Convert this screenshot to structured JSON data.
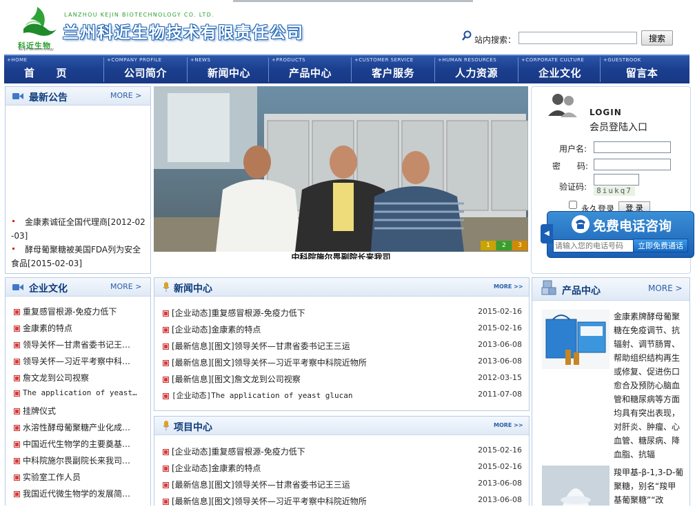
{
  "header": {
    "logo_cn": "科近生物",
    "logo_en": "Ke Jin Biotechnology",
    "company_en": "LANZHOU KEJIN BIOTECHNOLOGY CO. LTD.",
    "company_cn": "兰州科近生物技术有限责任公司",
    "search_label": "站内搜索：",
    "search_value": "",
    "search_button": "搜索"
  },
  "nav": [
    {
      "en": "+HOME",
      "cn": "首　　页"
    },
    {
      "en": "+COMPANY PROFILE",
      "cn": "公司简介"
    },
    {
      "en": "+NEWS",
      "cn": "新闻中心"
    },
    {
      "en": "+PRODUCTS",
      "cn": "产品中心"
    },
    {
      "en": "+CUSTOMER SERVICE",
      "cn": "客户服务"
    },
    {
      "en": "+HUMAN RESOURCES",
      "cn": "人力资源"
    },
    {
      "en": "+CORPORATE CULTURE",
      "cn": "企业文化"
    },
    {
      "en": "+GUESTBOOK",
      "cn": "留言本"
    }
  ],
  "announcements": {
    "title": "最新公告",
    "more": "MORE >",
    "items": [
      {
        "line1": "金康素诚征全国代理商[2012-02",
        "line2": "-03]"
      },
      {
        "line1": "酵母葡聚糖被美国FDA列为安全",
        "line2": "食品[2015-02-03]"
      }
    ]
  },
  "photo": {
    "caption": "中科院施尔畏副院长来我司",
    "slides": [
      "1",
      "2",
      "3"
    ]
  },
  "login": {
    "title_en": "LOGIN",
    "title_cn": "会员登陆入口",
    "username_label": "用户名:",
    "password_label": "密　　码:",
    "captcha_label": "验证码:",
    "captcha_text": "8iukq7",
    "remember_label": "永久登录",
    "login_button": "登 录"
  },
  "phone_widget": {
    "title": "免费电话咨询",
    "placeholder": "请输入您的电话号码",
    "button": "立即免费通话"
  },
  "culture": {
    "title": "企业文化",
    "more": "MORE >",
    "items": [
      "重复感冒根源-免疫力低下",
      "金康素的特点",
      "领导关怀—甘肃省委书记王…",
      "领导关怀—习近平考察中科…",
      "詹文龙到公司视察",
      "The application of yeast…",
      "挂牌仪式",
      "水溶性酵母葡聚糖产业化成…",
      "中国近代生物学的主要奠基…",
      "中科院施尔畏副院长来我司…",
      "实验室工作人员",
      "我国近代微生物学的发展简…"
    ]
  },
  "news": {
    "title": "新闻中心",
    "more": "MORE >>",
    "items": [
      {
        "title": "[企业动态]重复感冒根源-免疫力低下",
        "date": "2015-02-16"
      },
      {
        "title": "[企业动态]金康素的特点",
        "date": "2015-02-16"
      },
      {
        "title": "[最新信息][图文]领导关怀—甘肃省委书记王三运",
        "date": "2013-06-08"
      },
      {
        "title": "[最新信息][图文]领导关怀—习近平考察中科院近物所",
        "date": "2013-06-08"
      },
      {
        "title": "[最新信息][图文]詹文龙到公司视察",
        "date": "2012-03-15"
      },
      {
        "title": "[企业动态]The application of yeast glucan",
        "date": "2011-07-08"
      }
    ]
  },
  "projects": {
    "title": "项目中心",
    "more": "MORE >>",
    "items": [
      {
        "title": "[企业动态]重复感冒根源-免疫力低下",
        "date": "2015-02-16"
      },
      {
        "title": "[企业动态]金康素的特点",
        "date": "2015-02-16"
      },
      {
        "title": "[最新信息][图文]领导关怀—甘肃省委书记王三运",
        "date": "2013-06-08"
      },
      {
        "title": "[最新信息][图文]领导关怀—习近平考察中科院近物所",
        "date": "2013-06-08"
      }
    ]
  },
  "products": {
    "title": "产品中心",
    "more": "MORE >",
    "p1_desc": "金康素牌酵母葡聚糖在免疫调节、抗辐射、调节肠胃、帮助组织结构再生或修复、促进伤口愈合及预防心脑血管和糖尿病等方面均具有突出表现，对肝炎、肿瘤、心血管、糖尿病、降血脂、抗辐",
    "p2_desc": "羧甲基-β-1,3-D-葡聚糖，别名“羧甲基葡聚糖”“改"
  }
}
